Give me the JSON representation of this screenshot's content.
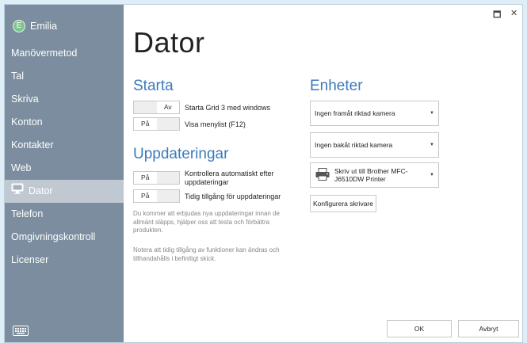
{
  "user": {
    "name": "Emilia",
    "initial": "E"
  },
  "sidebar": {
    "items": [
      {
        "label": "Manövermetod"
      },
      {
        "label": "Tal"
      },
      {
        "label": "Skriva"
      },
      {
        "label": "Konton"
      },
      {
        "label": "Kontakter"
      },
      {
        "label": "Web"
      },
      {
        "label": "Dator",
        "active": true
      },
      {
        "label": "Telefon"
      },
      {
        "label": "Omgivningskontroll"
      },
      {
        "label": "Licenser"
      }
    ]
  },
  "main": {
    "title": "Dator",
    "starta": {
      "heading": "Starta",
      "options": [
        {
          "toggle_left": "",
          "toggle_right": "Av",
          "label": "Starta Grid 3 med windows"
        },
        {
          "toggle_left": "På",
          "toggle_right": "",
          "label": "Visa menylist (F12)"
        }
      ]
    },
    "uppdateringar": {
      "heading": "Uppdateringar",
      "options": [
        {
          "toggle_left": "På",
          "toggle_right": "",
          "label": "Kontrollera automatiskt efter uppdateringar"
        },
        {
          "toggle_left": "På",
          "toggle_right": "",
          "label": "Tidig tillgång för uppdateringar"
        }
      ],
      "note1": "Du kommer att erbjudas nya uppdateringar innan de allmänt släpps, hjälper oss att testa och förbättra produkten.",
      "note2": "Notera att tidig tillgång av funktioner kan ändras och tillhandahålls i befintligt skick."
    },
    "enheter": {
      "heading": "Enheter",
      "front_camera": "Ingen framåt riktad kamera",
      "back_camera": "Ingen bakåt riktad kamera",
      "printer": "Skriv ut till Brother MFC-J6510DW Printer",
      "configure_label": "Konfigurera skrivare"
    }
  },
  "footer": {
    "ok_label": "OK",
    "cancel_label": "Avbryt"
  },
  "window_controls": {
    "restore": "🗖",
    "close": "✕"
  },
  "colors": {
    "sidebar": "#7b8d9e",
    "active_item": "#c0c9d1",
    "heading": "#3d7ab8",
    "avatar": "#7fc58f"
  }
}
